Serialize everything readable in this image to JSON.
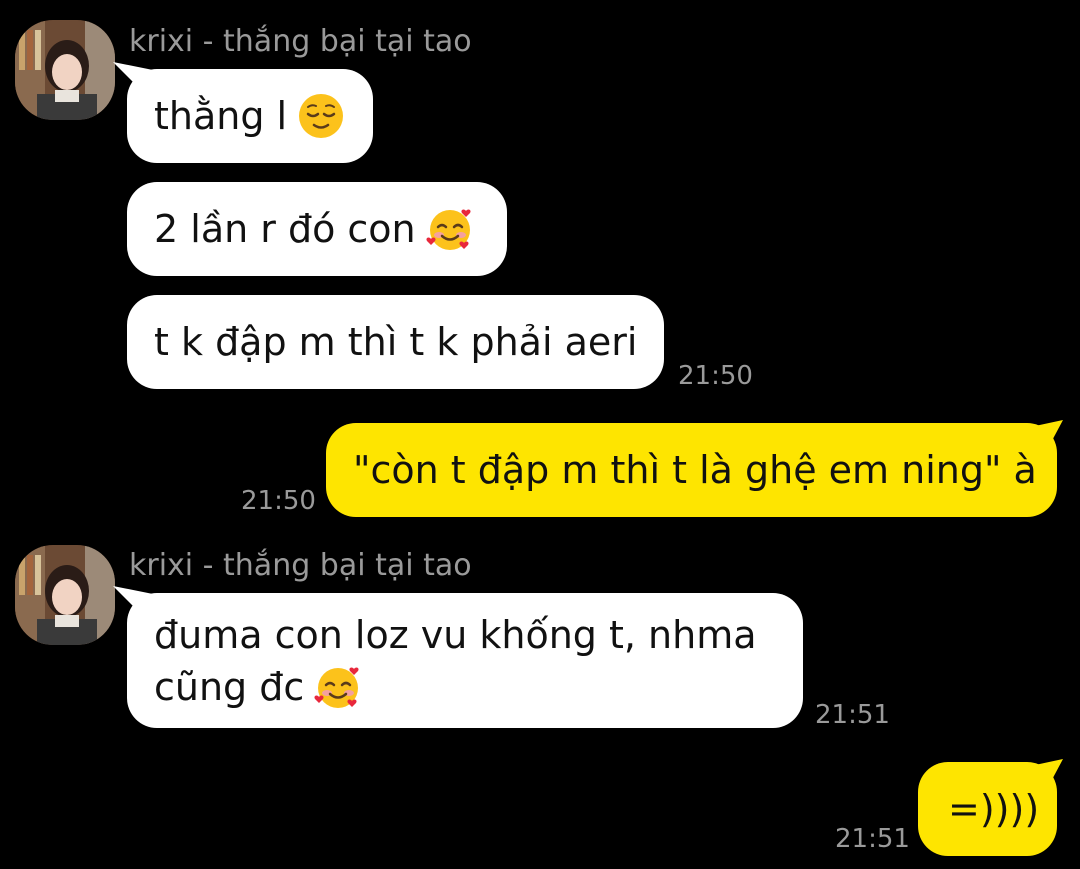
{
  "chat": {
    "groups": [
      {
        "sender": "krixi - thắng bại tại tao",
        "messages": [
          {
            "text": "thằng l",
            "emoji": "relieved-face-icon"
          },
          {
            "text": "2 lần r đó con",
            "emoji": "smiling-face-with-hearts-icon"
          },
          {
            "text": "t k đập m thì t k phải aeri",
            "time": "21:50"
          }
        ]
      },
      {
        "sender": "krixi - thắng bại tại tao",
        "messages": [
          {
            "text_line1": "đuma con loz vu khống t, nhma",
            "text_line2": "cũng đc",
            "emoji": "smiling-face-with-hearts-icon",
            "time": "21:51"
          }
        ]
      }
    ],
    "outgoing": [
      {
        "text": "\"còn t đập m thì t là ghệ em ning\" à",
        "time": "21:50"
      },
      {
        "text": "=))))",
        "time": "21:51"
      }
    ]
  },
  "colors": {
    "background": "#000000",
    "incoming_bubble": "#ffffff",
    "outgoing_bubble": "#fee500",
    "meta_text": "#9a9a9a"
  }
}
